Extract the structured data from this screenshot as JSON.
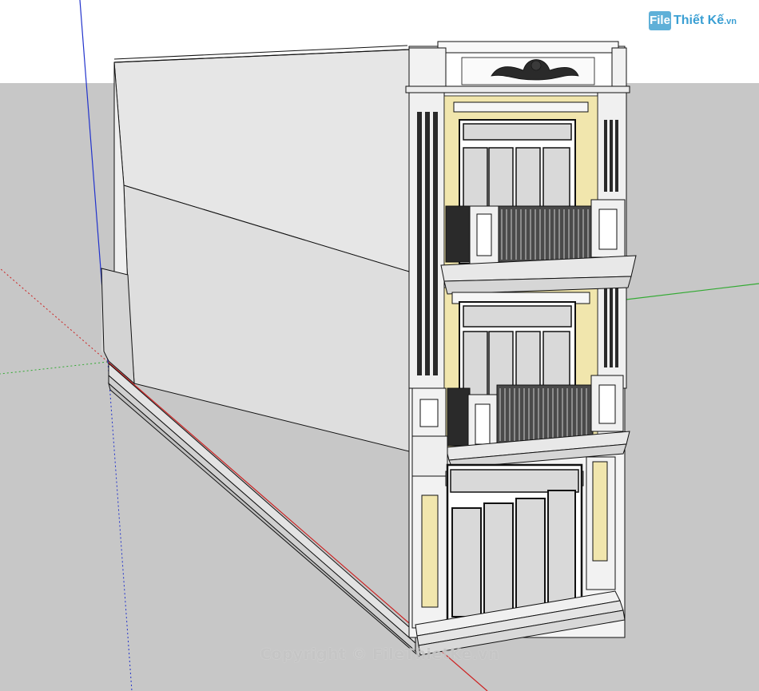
{
  "watermark": {
    "logo_box": "File",
    "logo_text": "Thiết Kế",
    "logo_suffix": ".vn",
    "copyright": "Copyright © FileThietKe.vn"
  },
  "viewport": {
    "ground_color": "#c7c7c7",
    "sky_color": "#ffffff",
    "axis_colors": {
      "red": "#cc2222",
      "green": "#33aa33",
      "blue": "#2233cc"
    },
    "accent_yellow": "#f1e6ad"
  }
}
